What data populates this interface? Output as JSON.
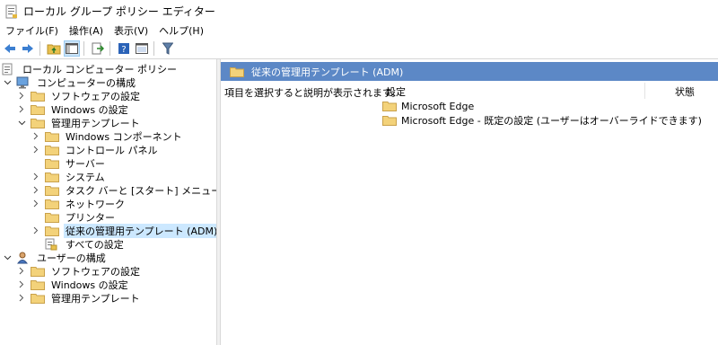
{
  "window": {
    "title": "ローカル グループ ポリシー エディター"
  },
  "menu": [
    "ファイル(F)",
    "操作(A)",
    "表示(V)",
    "ヘルプ(H)"
  ],
  "toolbar": {
    "buttons": [
      "back-arrow-icon",
      "forward-arrow-icon",
      "up-folder-icon",
      "show-hide-tree-icon",
      "export-list-icon",
      "help-icon",
      "properties-icon",
      "filter-icon"
    ],
    "active": "show-hide-tree-icon"
  },
  "tree": {
    "root": "ローカル コンピューター ポリシー",
    "computer": "コンピューターの構成",
    "c_software": "ソフトウェアの設定",
    "c_windows": "Windows の設定",
    "c_admin": "管理用テンプレート",
    "a_components": "Windows コンポーネント",
    "a_control": "コントロール パネル",
    "a_server": "サーバー",
    "a_system": "システム",
    "a_taskbar": "タスク バーと [スタート] メニュー",
    "a_network": "ネットワーク",
    "a_printer": "プリンター",
    "a_classic": "従来の管理用テンプレート (ADM)",
    "a_all": "すべての設定",
    "user": "ユーザーの構成",
    "u_software": "ソフトウェアの設定",
    "u_windows": "Windows の設定",
    "u_admin": "管理用テンプレート"
  },
  "details": {
    "header": "従来の管理用テンプレート (ADM)",
    "description": "項目を選択すると説明が表示されます。",
    "col_setting": "設定",
    "col_state": "状態",
    "items": [
      "Microsoft Edge",
      "Microsoft Edge - 既定の設定 (ユーザーはオーバーライドできます)"
    ]
  },
  "colors": {
    "header_bar": "#5c88c6",
    "selection": "#cce8ff",
    "folder": "#e8c04f"
  }
}
